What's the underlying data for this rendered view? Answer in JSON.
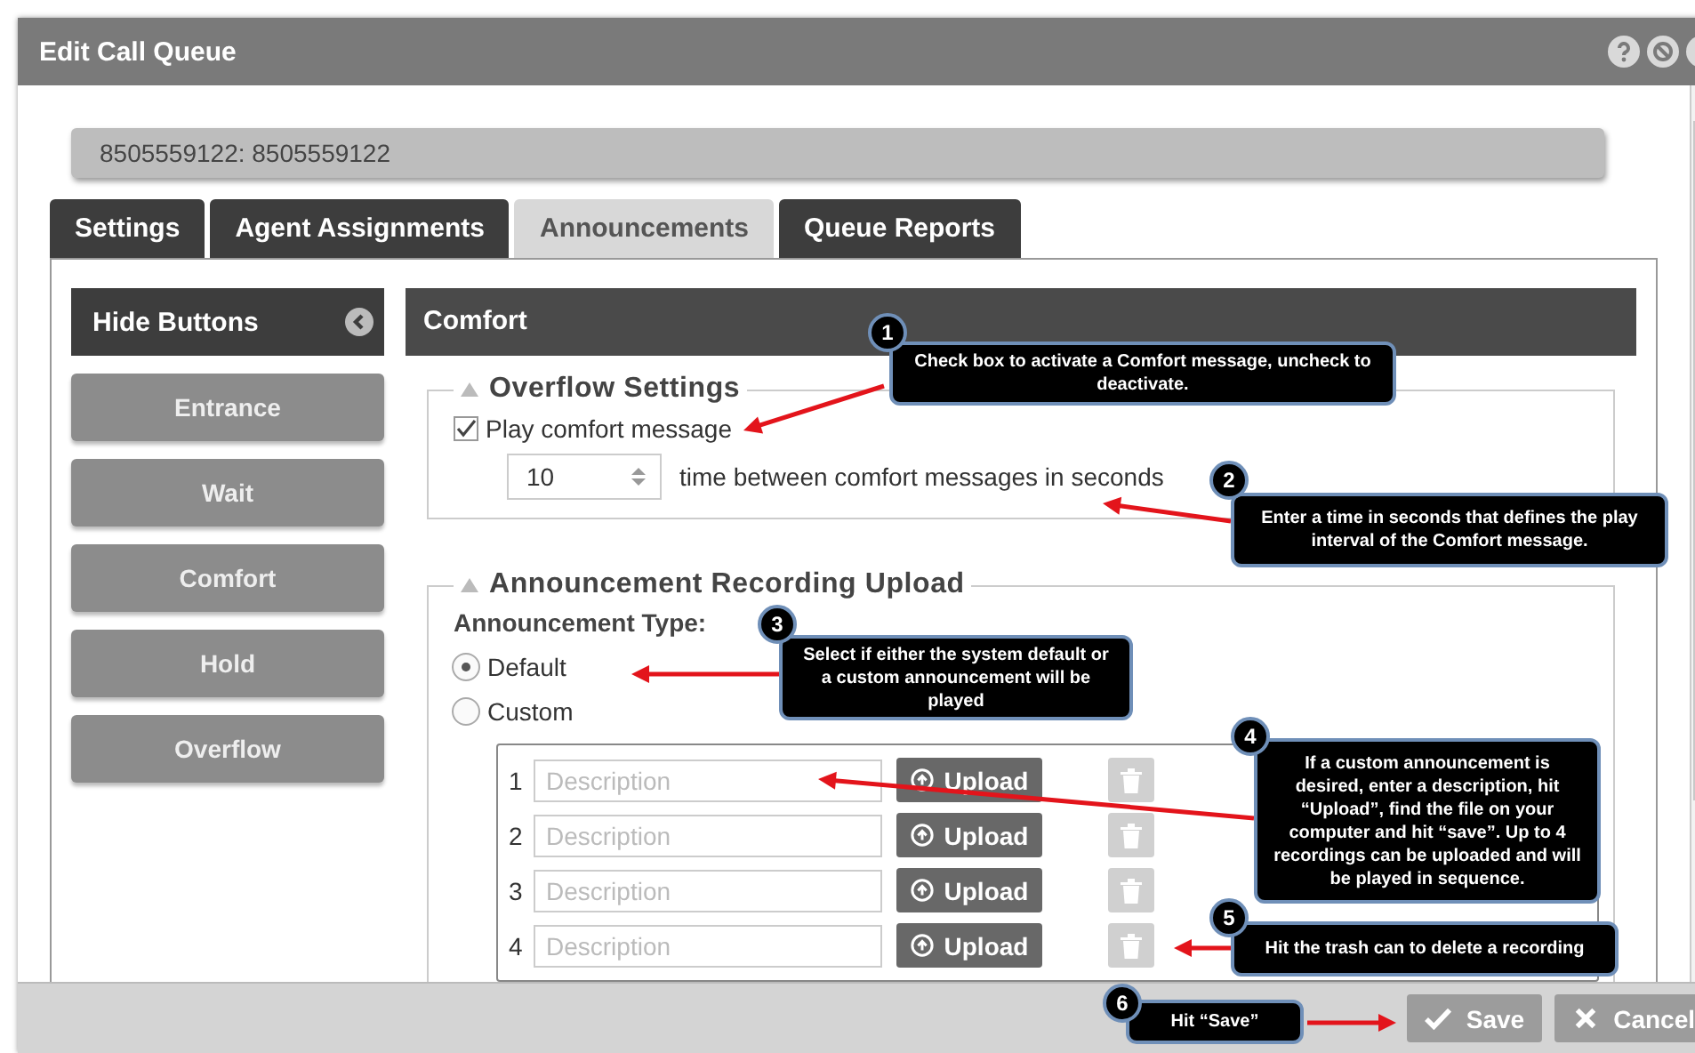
{
  "window": {
    "title": "Edit Call Queue"
  },
  "record_name": "8505559122: 8505559122",
  "tabs": [
    {
      "label": "Settings",
      "selected": false
    },
    {
      "label": "Agent Assignments",
      "selected": false
    },
    {
      "label": "Announcements",
      "selected": true
    },
    {
      "label": "Queue Reports",
      "selected": false
    }
  ],
  "sidebar": {
    "header": "Hide Buttons",
    "items": [
      {
        "label": "Entrance"
      },
      {
        "label": "Wait"
      },
      {
        "label": "Comfort"
      },
      {
        "label": "Hold"
      },
      {
        "label": "Overflow"
      }
    ]
  },
  "panel": {
    "title": "Comfort",
    "overflow_settings": {
      "title": "Overflow Settings",
      "play_comfort": {
        "label": "Play comfort message",
        "checked": true
      },
      "interval": {
        "value": "10",
        "label": "time between comfort messages in seconds"
      }
    },
    "upload": {
      "title": "Announcement Recording Upload",
      "type_label": "Announcement Type:",
      "options": [
        {
          "label": "Default",
          "selected": true
        },
        {
          "label": "Custom",
          "selected": false
        }
      ],
      "recordings": [
        {
          "number": "1",
          "placeholder": "Description",
          "upload_label": "Upload"
        },
        {
          "number": "2",
          "placeholder": "Description",
          "upload_label": "Upload"
        },
        {
          "number": "3",
          "placeholder": "Description",
          "upload_label": "Upload"
        },
        {
          "number": "4",
          "placeholder": "Description",
          "upload_label": "Upload"
        }
      ]
    }
  },
  "footer_buttons": [
    {
      "kind": "save",
      "label": "Save"
    },
    {
      "kind": "cancel",
      "label": "Cancel"
    }
  ],
  "callouts": [
    {
      "number": "1",
      "text": "Check box to activate a Comfort message, uncheck to deactivate."
    },
    {
      "number": "2",
      "text": "Enter a time in seconds that defines the play interval of the Comfort message."
    },
    {
      "number": "3",
      "text": "Select if either the system default or a custom announcement will be played"
    },
    {
      "number": "4",
      "text": "If a custom announcement is desired, enter a description, hit “Upload”, find the file on your computer  and hit “save”. Up to 4 recordings can be uploaded and will be played  in sequence."
    },
    {
      "number": "5",
      "text": "Hit the trash can to delete a recording"
    },
    {
      "number": "6",
      "text": "Hit “Save”"
    }
  ]
}
